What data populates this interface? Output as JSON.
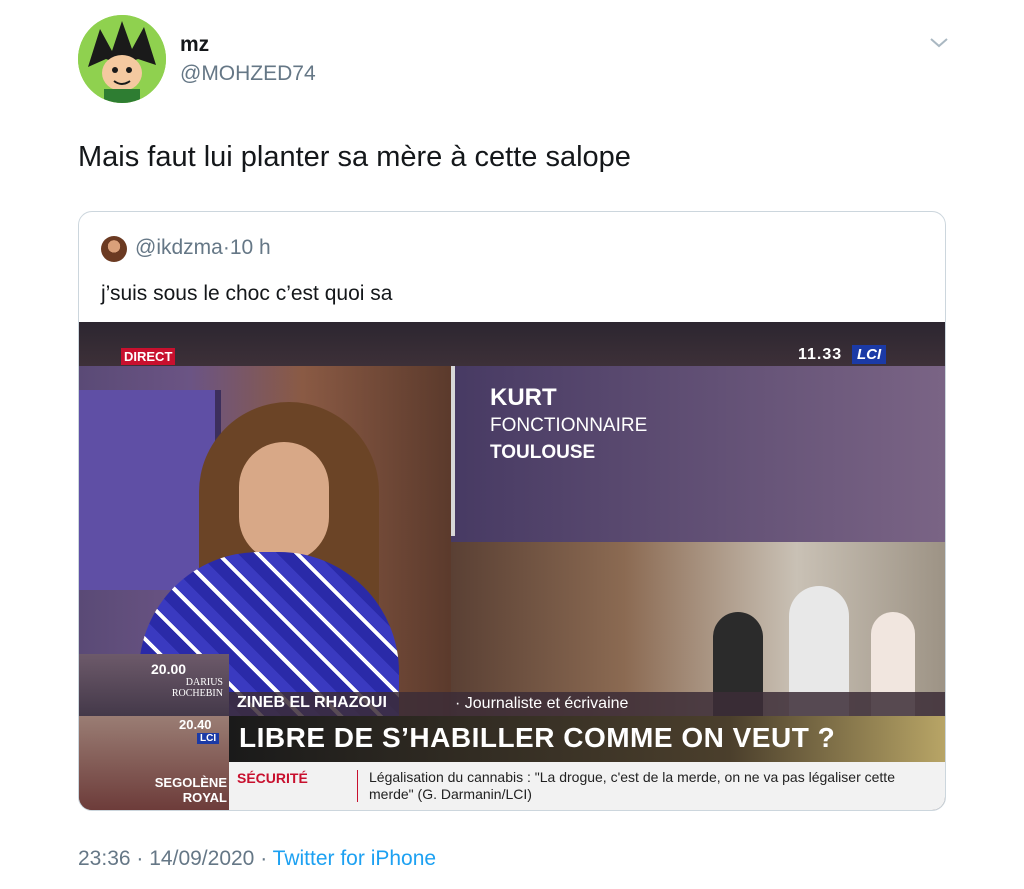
{
  "author": {
    "display_name": "mz",
    "handle": "@MOHZED74",
    "avatar_icon": "cartoon-avatar"
  },
  "menu_icon": "chevron-down-icon",
  "tweet": {
    "text": "Mais faut lui planter sa mère à cette salope"
  },
  "quoted_tweet": {
    "handle": "@ikdzma",
    "separator": "·",
    "time": "10 h",
    "text": "j’suis sous le choc c’est quoi sa",
    "video": {
      "live_badge": "DIRECT",
      "clock": "11.33",
      "channel": "LCI",
      "interviewee_name": "KURT",
      "interviewee_job": "FONCTIONNAIRE",
      "interviewee_city": "TOULOUSE",
      "pip_time": "20.00",
      "pip_name": "DARIUS ROCHEBIN",
      "presenter_name": "ZINEB EL RHAZOUI",
      "presenter_role": "· Journaliste et écrivaine",
      "next_time": "20.40",
      "next_channel": "LCI",
      "next_name": "SEGOLÈNE ROYAL",
      "headline": "LIBRE DE S’HABILLER COMME ON VEUT ?",
      "ticker_category": "SÉCURITÉ",
      "ticker_text": "Légalisation du cannabis : \"La drogue, c'est de la merde, on ne va pas légaliser cette merde\" (G. Darmanin/LCI)"
    }
  },
  "footer": {
    "time": "23:36",
    "sep1": "·",
    "date": "14/09/2020",
    "sep2": "·",
    "source": "Twitter for iPhone"
  },
  "colors": {
    "link": "#1da1f2",
    "muted": "#657786",
    "text": "#14171a",
    "border": "#ccd6dd"
  }
}
